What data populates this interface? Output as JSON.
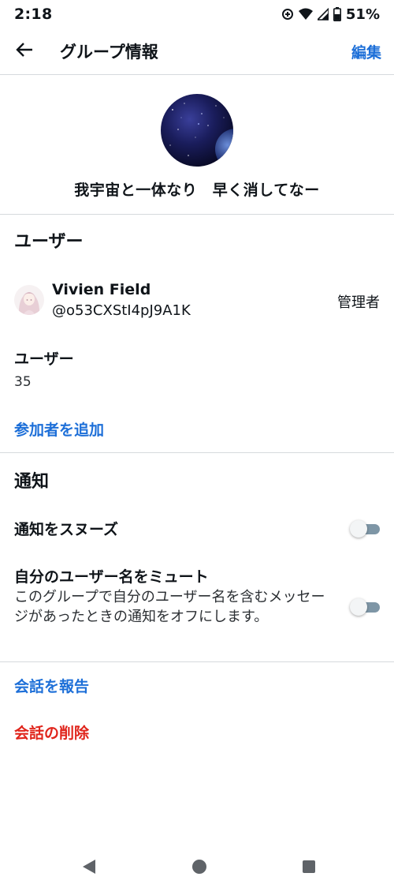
{
  "status_bar": {
    "time": "2:18",
    "battery": "51%",
    "icons": [
      "data-saver-icon",
      "wifi-icon",
      "cell-signal-icon",
      "battery-icon"
    ]
  },
  "header": {
    "title": "グループ情報",
    "edit_label": "編集",
    "back_icon": "back-arrow-icon"
  },
  "group": {
    "name": "我宇宙と一体なり　早く消してなー"
  },
  "users_section": {
    "title": "ユーザー",
    "member": {
      "name": "Vivien Field",
      "handle": "@o53CXStI4pJ9A1K",
      "role": "管理者"
    },
    "count_label": "ユーザー",
    "count_value": "35",
    "add_participant": "参加者を追加"
  },
  "notifications_section": {
    "title": "通知",
    "snooze_label": "通知をスヌーズ",
    "snooze_on": false,
    "mute_label": "自分のユーザー名をミュート",
    "mute_desc": "このグループで自分のユーザー名を含むメッセージがあったときの通知をオフにします。",
    "mute_on": false
  },
  "actions": {
    "report": "会話を報告",
    "delete": "会話の削除"
  },
  "colors": {
    "accent": "#1d6fd8",
    "danger": "#e0241b",
    "divider": "#d6dadd"
  }
}
